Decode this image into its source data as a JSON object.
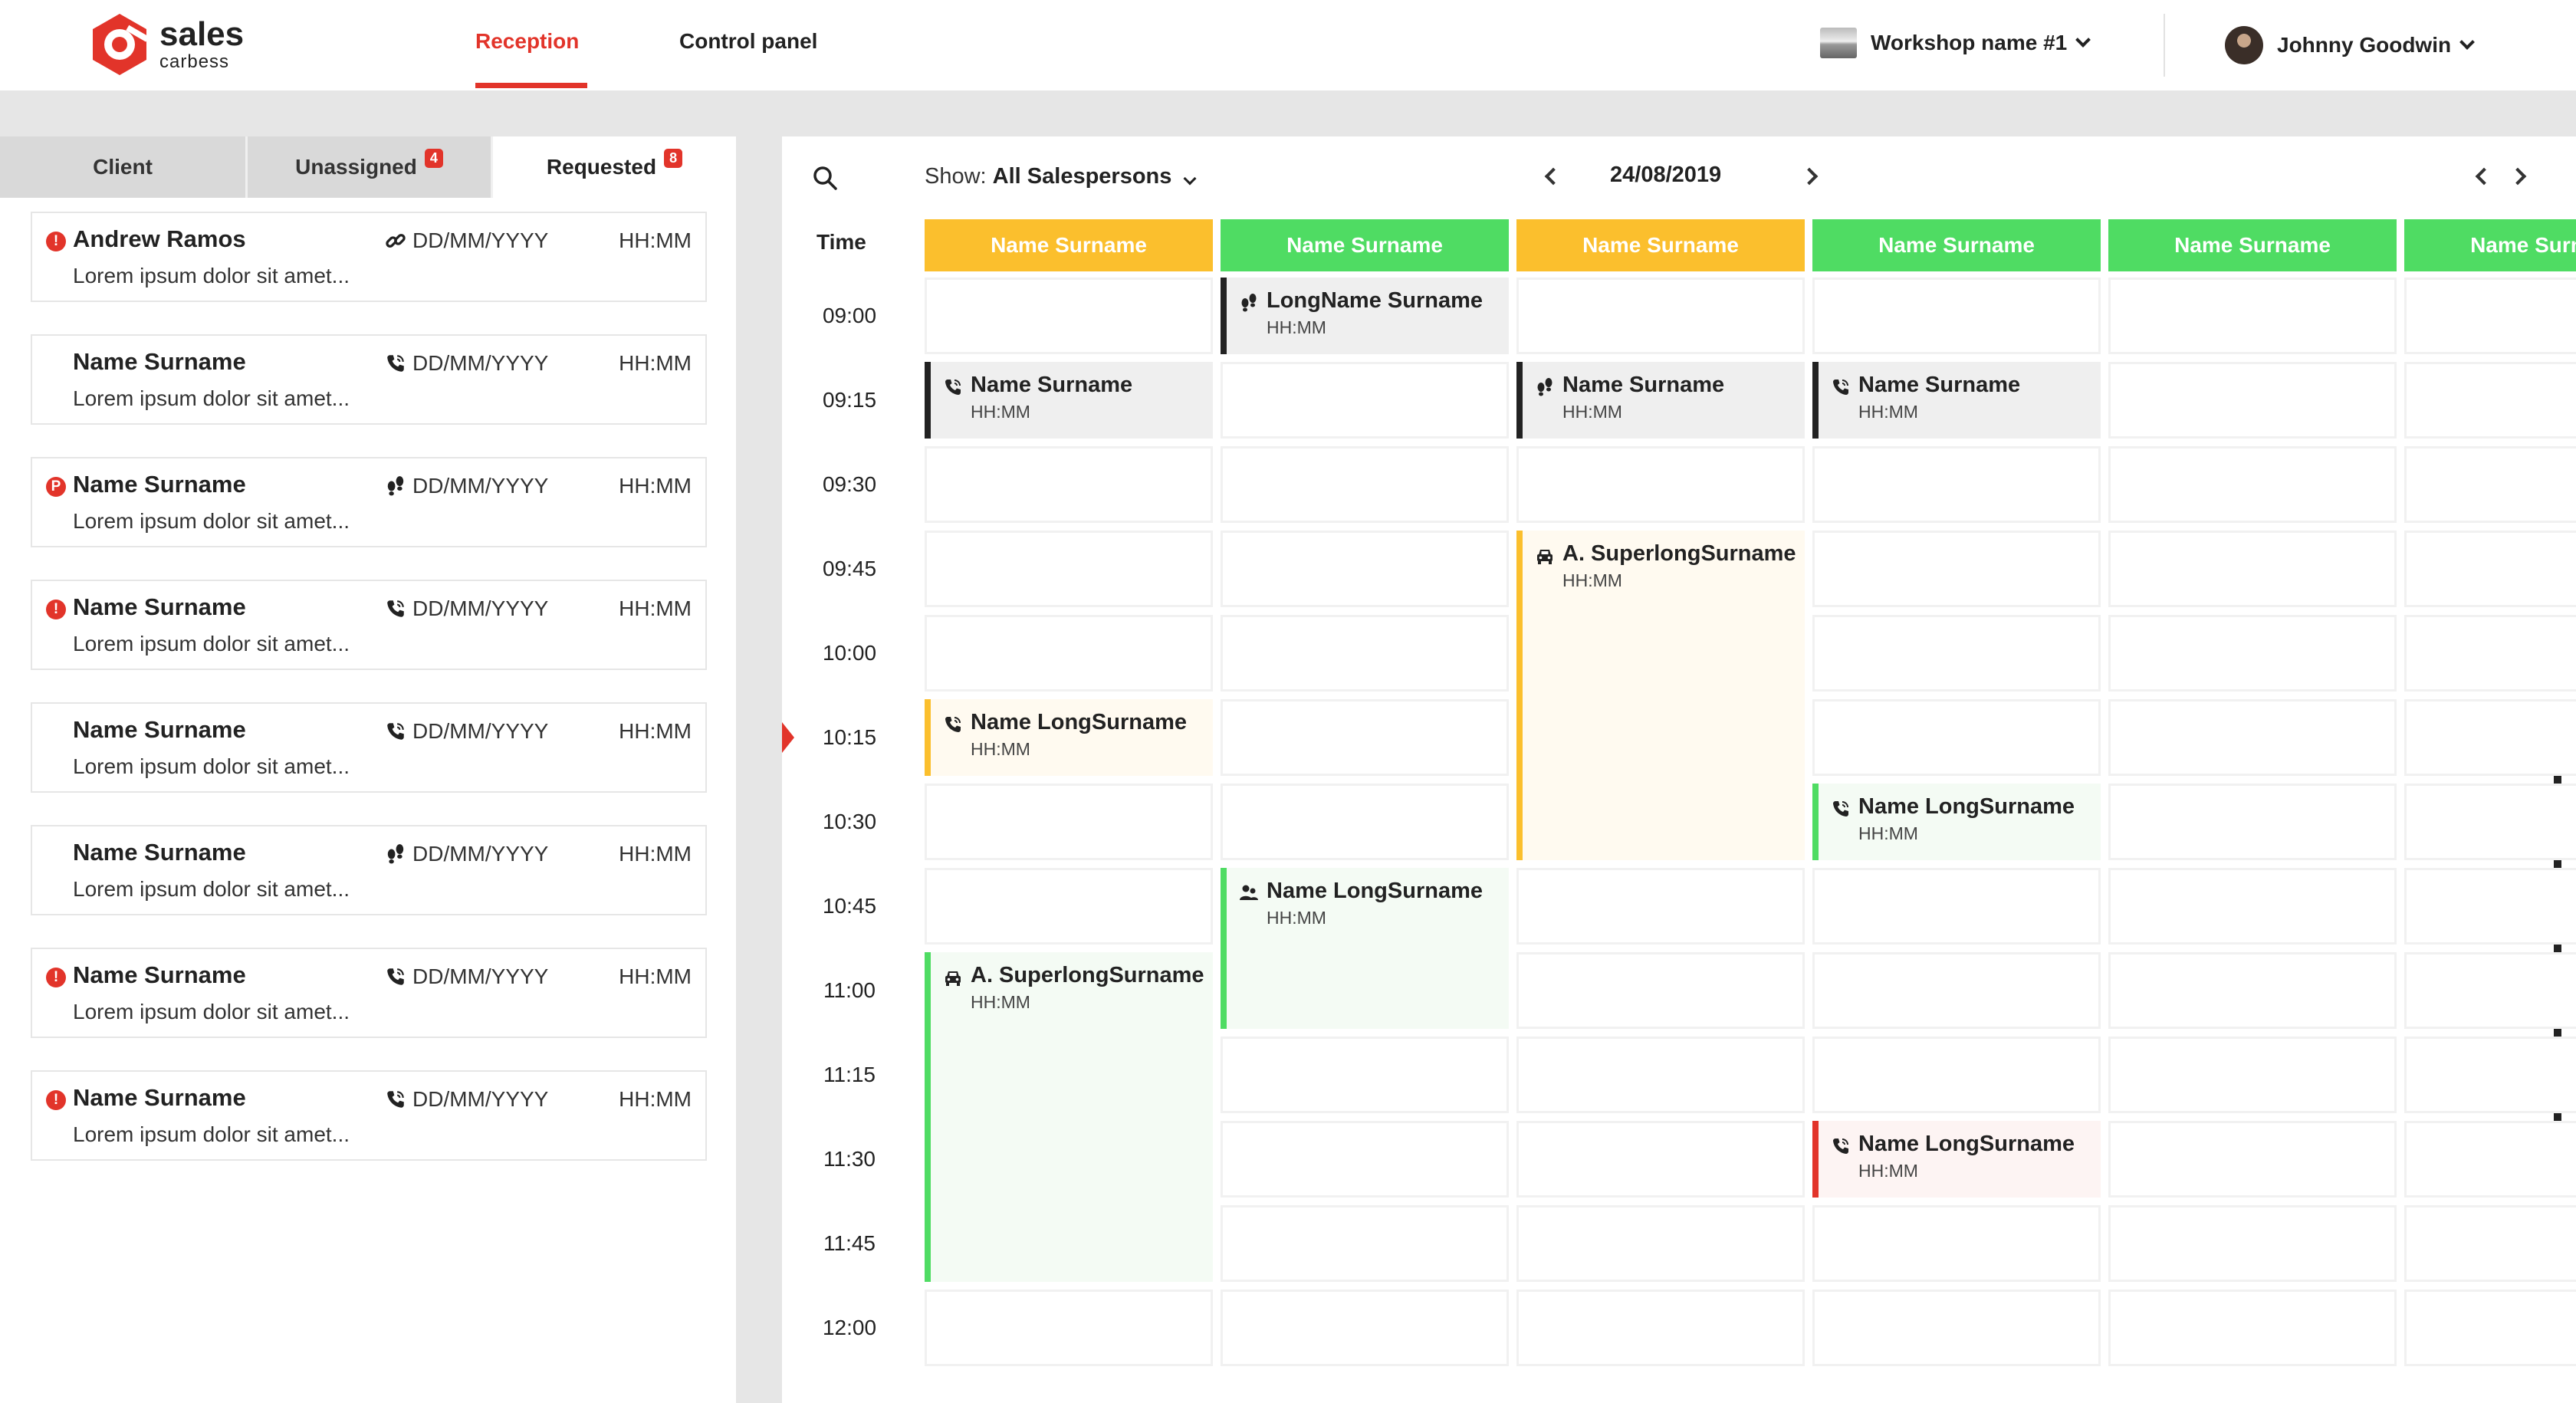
{
  "brand": {
    "line1": "sales",
    "line2": "carbess"
  },
  "nav": {
    "reception": "Reception",
    "control_panel": "Control panel"
  },
  "workshop": {
    "name": "Workshop name #1"
  },
  "user": {
    "name": "Johnny Goodwin"
  },
  "colors": {
    "accent": "#e2342a",
    "yellow": "#fbbf2d",
    "green": "#4fdc63",
    "red": "#e2342a",
    "dark": "#222222"
  },
  "tabs": [
    {
      "label": "Client",
      "badge": ""
    },
    {
      "label": "Unassigned",
      "badge": "4"
    },
    {
      "label": "Requested",
      "badge": "8"
    }
  ],
  "list_items": [
    {
      "alert": "!",
      "name": "Andrew Ramos",
      "icon": "link-icon",
      "date": "DD/MM/YYYY",
      "time": "HH:MM",
      "desc": "Lorem ipsum dolor sit amet..."
    },
    {
      "alert": "",
      "name": "Name Surname",
      "icon": "phone-icon",
      "date": "DD/MM/YYYY",
      "time": "HH:MM",
      "desc": "Lorem ipsum dolor sit amet..."
    },
    {
      "alert": "P",
      "name": "Name Surname",
      "icon": "footprints-icon",
      "date": "DD/MM/YYYY",
      "time": "HH:MM",
      "desc": "Lorem ipsum dolor sit amet..."
    },
    {
      "alert": "!",
      "name": "Name Surname",
      "icon": "phone-icon",
      "date": "DD/MM/YYYY",
      "time": "HH:MM",
      "desc": "Lorem ipsum dolor sit amet..."
    },
    {
      "alert": "",
      "name": "Name Surname",
      "icon": "phone-icon",
      "date": "DD/MM/YYYY",
      "time": "HH:MM",
      "desc": "Lorem ipsum dolor sit amet..."
    },
    {
      "alert": "",
      "name": "Name Surname",
      "icon": "footprints-icon",
      "date": "DD/MM/YYYY",
      "time": "HH:MM",
      "desc": "Lorem ipsum dolor sit amet..."
    },
    {
      "alert": "!",
      "name": "Name Surname",
      "icon": "phone-icon",
      "date": "DD/MM/YYYY",
      "time": "HH:MM",
      "desc": "Lorem ipsum dolor sit amet..."
    },
    {
      "alert": "!",
      "name": "Name Surname",
      "icon": "phone-icon",
      "date": "DD/MM/YYYY",
      "time": "HH:MM",
      "desc": "Lorem ipsum dolor sit amet..."
    }
  ],
  "calendar": {
    "show_label": "Show:",
    "show_value": "All Salespersons",
    "date": "24/08/2019",
    "time_header": "Time",
    "times": [
      "09:00",
      "09:15",
      "09:30",
      "09:45",
      "10:00",
      "10:15",
      "10:30",
      "10:45",
      "11:00",
      "11:15",
      "11:30",
      "11:45",
      "12:00"
    ],
    "current_slot": 5,
    "columns": [
      {
        "name": "Name Surname",
        "color": "yellow"
      },
      {
        "name": "Name Surname",
        "color": "green"
      },
      {
        "name": "Name Surname",
        "color": "yellow"
      },
      {
        "name": "Name Surname",
        "color": "green"
      },
      {
        "name": "Name Surname",
        "color": "green"
      },
      {
        "name": "Name Surname",
        "color": "green"
      }
    ],
    "events": [
      {
        "col": 1,
        "start": 0,
        "span": 1,
        "name": "LongName Surname",
        "time": "HH:MM",
        "icon": "footprints-icon",
        "bar": "dark",
        "bg": "#efefef"
      },
      {
        "col": 0,
        "start": 1,
        "span": 1,
        "name": "Name Surname",
        "time": "HH:MM",
        "icon": "phone-icon",
        "bar": "dark",
        "bg": "#efefef"
      },
      {
        "col": 2,
        "start": 1,
        "span": 1,
        "name": "Name Surname",
        "time": "HH:MM",
        "icon": "footprints-icon",
        "bar": "dark",
        "bg": "#efefef"
      },
      {
        "col": 3,
        "start": 1,
        "span": 1,
        "name": "Name Surname",
        "time": "HH:MM",
        "icon": "phone-icon",
        "bar": "dark",
        "bg": "#efefef"
      },
      {
        "col": 2,
        "start": 3,
        "span": 4,
        "name": "A. SuperlongSurname",
        "time": "HH:MM",
        "icon": "car-icon",
        "bar": "yellow",
        "bg": "#fffaf0"
      },
      {
        "col": 0,
        "start": 5,
        "span": 1,
        "name": "Name LongSurname",
        "time": "HH:MM",
        "icon": "phone-icon",
        "bar": "yellow",
        "bg": "#fffaf0"
      },
      {
        "col": 3,
        "start": 6,
        "span": 1,
        "name": "Name LongSurname",
        "time": "HH:MM",
        "icon": "phone-icon",
        "bar": "green",
        "bg": "#f4fbf4"
      },
      {
        "col": 1,
        "start": 7,
        "span": 2,
        "name": "Name LongSurname",
        "time": "HH:MM",
        "icon": "people-icon",
        "bar": "green",
        "bg": "#f4fbf4"
      },
      {
        "col": 0,
        "start": 8,
        "span": 4,
        "name": "A. SuperlongSurname",
        "time": "HH:MM",
        "icon": "car-icon",
        "bar": "green",
        "bg": "#f4fbf4"
      },
      {
        "col": 3,
        "start": 10,
        "span": 1,
        "name": "Name LongSurname",
        "time": "HH:MM",
        "icon": "phone-icon",
        "bar": "red",
        "bg": "#fdf4f3"
      }
    ]
  }
}
